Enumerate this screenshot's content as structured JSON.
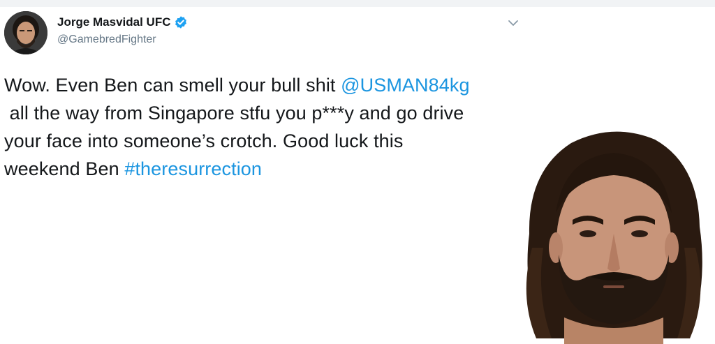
{
  "author": {
    "name": "Jorge Masvidal UFC",
    "handle": "@GamebredFighter",
    "verified": true
  },
  "icons": {
    "verified": "verified-badge-icon",
    "menu": "chevron-down-icon"
  },
  "tweet": {
    "line1_text": "Wow. Even Ben can smell your bull shit ",
    "mention": "@USMAN84kg",
    "line2_text": " all the way from Singapore stfu you p***y and go drive",
    "line3_text": "your face into someone’s crotch. Good luck this",
    "line4_text": "weekend Ben ",
    "hashtag": "#theresurrection"
  },
  "colors": {
    "link": "#1b95e0",
    "verified": "#1da1f2",
    "handle": "#657786",
    "text": "#14171a"
  }
}
